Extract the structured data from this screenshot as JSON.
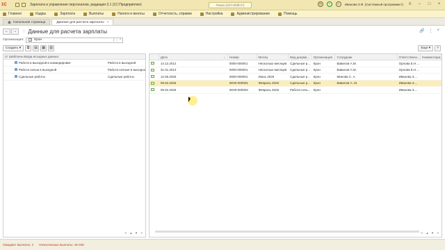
{
  "app": {
    "title": "Зарплата и управление персоналом, редакция 3.1  (1С:Предприятие)",
    "search_text": "Поиск (Ctrl+Shift+F)",
    "user_name": "Иванова З.Ф. (Системный программист)"
  },
  "menu": [
    {
      "label": "Главное"
    },
    {
      "label": "Кадры"
    },
    {
      "label": "Зарплата"
    },
    {
      "label": "Выплаты"
    },
    {
      "label": "Налоги и взносы"
    },
    {
      "label": "Отчетность, справки"
    },
    {
      "label": "Настройка"
    },
    {
      "label": "Администрирование"
    },
    {
      "label": "Помощь"
    }
  ],
  "tabs": [
    {
      "label": "Начальная страница"
    },
    {
      "label": "Данные для расчета зарплаты"
    }
  ],
  "page": {
    "title": "Данные для расчета зарплаты",
    "org_label": "Организация:",
    "org_value": "Крон",
    "create_label": "Создать",
    "more_label": "Еще",
    "help_label": "?"
  },
  "left_panel": {
    "header": "Шаблоны ввода исходных данных",
    "rows": [
      {
        "name": "Работа в выходной в командировке",
        "value": "Работа в выходной"
      },
      {
        "name": "Работа ночью в выходной",
        "value": "Работа ночные в выходной"
      },
      {
        "name": "Сдельные работы",
        "value": "Сдельные работы"
      }
    ]
  },
  "grid": {
    "columns": [
      "Дата",
      "Номер",
      "Месяц",
      "Вид докуме...",
      "Организация",
      "Сотрудник",
      "Ответственн...",
      "Комментари..."
    ],
    "rows": [
      {
        "date": "14.12.2012",
        "number": "0000-000001",
        "month": "Несколько месяцев",
        "type": "Сдельные р...",
        "org": "Крон",
        "employee": "Вавилов А.М.",
        "responsible": "Орлова Е.Н....",
        "comment": "",
        "selected": false
      },
      {
        "date": "31.01.2013",
        "number": "0000-000001",
        "month": "Несколько месяцев",
        "type": "Сдельные р...",
        "org": "Крон",
        "employee": "Вавилов А.М.",
        "responsible": "Орлова Е.Н....",
        "comment": "",
        "selected": false
      },
      {
        "date": "12.06.2025",
        "number": "0000-000001",
        "month": "Июнь 2025",
        "type": "Сдельные р...",
        "org": "Крон",
        "employee": "Минова С. А.",
        "responsible": "Иванова З....",
        "comment": "",
        "selected": false
      },
      {
        "date": "09.02.2026",
        "number": "0K00-000001",
        "month": "Февраль 2026",
        "type": "Сдельные р...",
        "org": "Крон",
        "employee": "Вавилов А. М.",
        "responsible": "Иванова З....",
        "comment": "",
        "selected": true
      },
      {
        "date": "09.02.2026",
        "number": "0K00-000002",
        "month": "Февраль 2026",
        "type": "Работа ночь...",
        "org": "Крон",
        "employee": "",
        "responsible": "Иванова З....",
        "comment": "",
        "selected": false
      }
    ]
  },
  "status": {
    "left": "Ожидают выплаты: 2",
    "right": "Начисленные выплаты: 45 048"
  },
  "colors": {
    "title_bar": "#f2e7b3",
    "selected_row": "#fbeeb7",
    "status_text": "#c0392b"
  }
}
